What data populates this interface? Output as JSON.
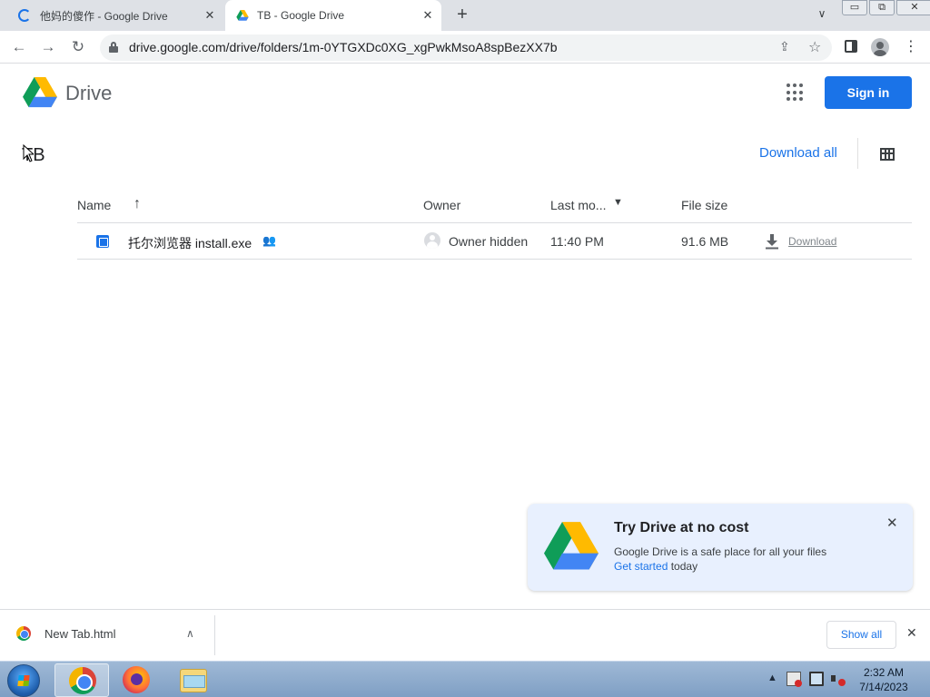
{
  "browser": {
    "tabs": [
      {
        "title": "他妈的傻作 - Google Drive",
        "active": false,
        "icon": "loading-spinner-icon"
      },
      {
        "title": "TB - Google Drive",
        "active": true,
        "icon": "google-drive-icon"
      }
    ],
    "new_tab_symbol": "+",
    "tab_search_symbol": "∨",
    "window_controls": {
      "minimize": "▭",
      "maximize": "⧉",
      "close": "✕"
    },
    "url": "drive.google.com/drive/folders/1m-0YTGXDc0XG_xgPwkMsoA8spBezXX7b"
  },
  "drive": {
    "brand": "Drive",
    "sign_in_label": "Sign in",
    "folder_title": "TB",
    "download_all_label": "Download all",
    "columns": {
      "name": "Name",
      "owner": "Owner",
      "last_modified": "Last mo...",
      "file_size": "File size"
    },
    "sort_arrow": "↑",
    "files": [
      {
        "name": "托尔浏览器 install.exe",
        "shared_icon": "👥",
        "owner": "Owner hidden",
        "modified": "11:40 PM",
        "size": "91.6 MB",
        "download_label": "Download"
      }
    ]
  },
  "promo": {
    "title": "Try Drive at no cost",
    "description": "Google Drive is a safe place for all your files",
    "link_text": "Get started",
    "link_suffix": " today",
    "close_symbol": "✕"
  },
  "download_shelf": {
    "item_name": "New Tab.html",
    "chevron": "∧",
    "show_all_label": "Show all",
    "close_symbol": "✕"
  },
  "taskbar": {
    "tray_arrow": "▲",
    "time": "2:32 AM",
    "date": "7/14/2023"
  },
  "colors": {
    "accent": "#1a73e8",
    "tabstrip": "#dee1e6",
    "promo_bg": "#e8f0fe"
  }
}
